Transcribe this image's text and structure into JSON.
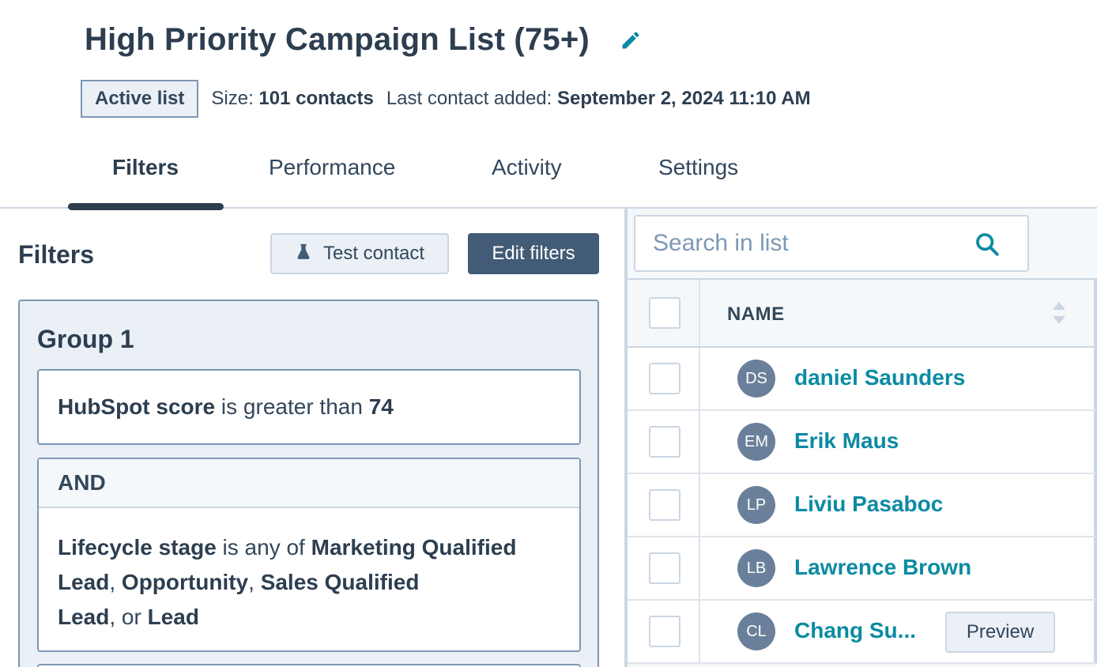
{
  "header": {
    "title": "High Priority Campaign List (75+)",
    "badge": "Active list",
    "size_label": "Size:",
    "size_value": "101 contacts",
    "last_added_label": "Last contact added:",
    "last_added_value": "September 2, 2024 11:10 AM"
  },
  "tabs": [
    "Filters",
    "Performance",
    "Activity",
    "Settings"
  ],
  "active_tab": "Filters",
  "filters_panel": {
    "heading": "Filters",
    "test_contact_label": "Test contact",
    "edit_filters_label": "Edit filters",
    "group": {
      "title": "Group 1",
      "filter1": {
        "property": "HubSpot score",
        "operator": " is greater than ",
        "value": "74"
      },
      "and_label": "AND",
      "filter2": {
        "property": "Lifecycle stage",
        "operator": " is any of ",
        "v1": "Marketing Qualified Lead",
        "sep1": ", ",
        "v2": "Opportunity",
        "sep2": ", ",
        "v3": "Sales Qualified Lead",
        "sep3": ", or ",
        "v4": "Lead"
      }
    }
  },
  "contacts_panel": {
    "search_placeholder": "Search in list",
    "column_name": "NAME",
    "preview_label": "Preview",
    "rows": [
      {
        "initials": "DS",
        "name": "daniel Saunders"
      },
      {
        "initials": "EM",
        "name": "Erik Maus"
      },
      {
        "initials": "LP",
        "name": "Liviu Pasaboc"
      },
      {
        "initials": "LB",
        "name": "Lawrence Brown"
      },
      {
        "initials": "CL",
        "name": "Chang Su..."
      }
    ]
  },
  "colors": {
    "accent": "#0b8ba3",
    "primary_button": "#425b76",
    "text_dark": "#2d3e50",
    "avatar": "#6a7f9a"
  },
  "icons": {
    "edit": "pencil-icon",
    "test": "flask-icon",
    "search": "search-icon",
    "sort": "sort-icon"
  }
}
